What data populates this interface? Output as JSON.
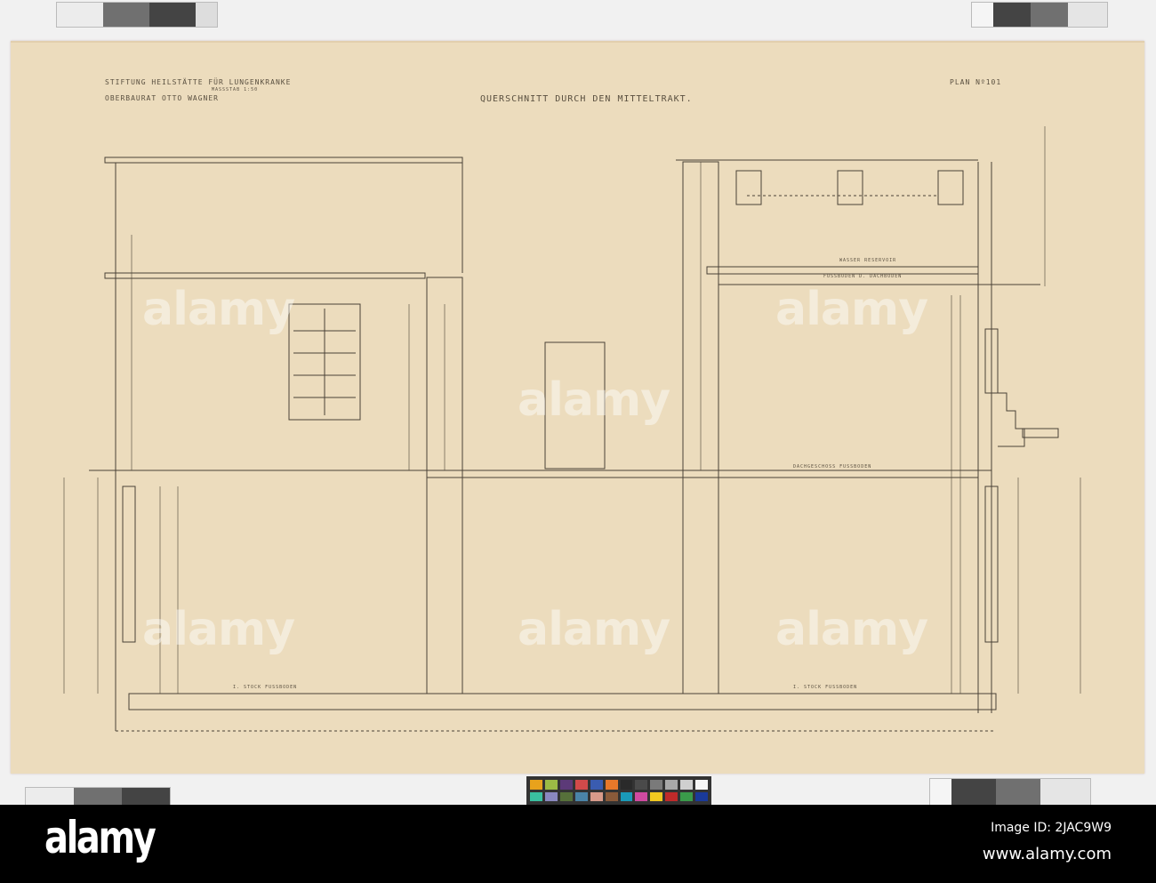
{
  "drawing": {
    "title_block": {
      "line1": "STIFTUNG HEILSTÄTTE FÜR LUNGENKRANKE",
      "scale": "MASSSTAB 1:50",
      "line2": "OBERBAURAT OTTO WAGNER"
    },
    "plan_number": "PLAN Nº101",
    "section_title": "QUERSCHNITT DURCH DEN MITTELTRAKT.",
    "room_labels": [
      "WASSER RESERVOIR",
      "FUSSBODEN D. DACHBODEN",
      "DACHGESCHOSS FUSSBODEN",
      "I. STOCK FUSSBODEN",
      "I. STOCK FUSSBODEN"
    ]
  },
  "watermark": "alamy",
  "footer": {
    "logo": "alamy",
    "image_id": "Image ID: 2JAC9W9",
    "url": "www.alamy.com"
  },
  "colors": {
    "paper": "#ecdcbd",
    "ink": "#4a4236",
    "checker": [
      "#e8a21c",
      "#9bbb45",
      "#5c3a78",
      "#d24a4a",
      "#3a5cb0",
      "#e8782a",
      "#2a2a2a",
      "#4a4a4a",
      "#7a7a7a",
      "#a8a8a8",
      "#cfcfcf",
      "#f5f5f5",
      "#3ac0a0",
      "#8a88c0",
      "#56703a",
      "#4a84a8",
      "#d89a8a",
      "#8a5a3a",
      "#1a9ab8",
      "#d04aa0",
      "#f0c820",
      "#c02a2a",
      "#3a9a4a",
      "#1a3a9a"
    ]
  }
}
